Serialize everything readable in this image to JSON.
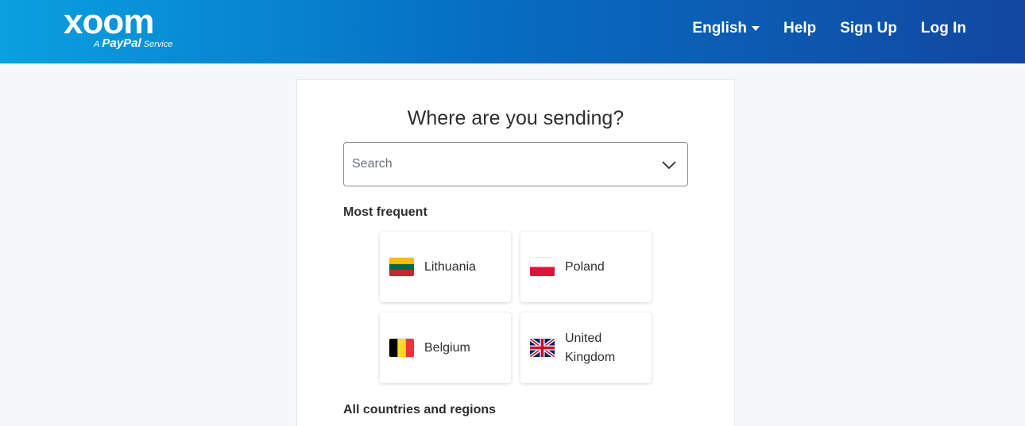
{
  "header": {
    "logo": {
      "wordmark": "xoom",
      "tagline_prefix": "A",
      "tagline_brand": "PayPal",
      "tagline_suffix": "Service"
    },
    "nav": {
      "language": "English",
      "help": "Help",
      "sign_up": "Sign Up",
      "log_in": "Log In"
    }
  },
  "main": {
    "title": "Where are you sending?",
    "search": {
      "placeholder": "Search",
      "value": ""
    },
    "most_frequent_label": "Most frequent",
    "all_label": "All countries and regions",
    "countries": [
      {
        "name": "Lithuania",
        "flag": "lithuania-flag"
      },
      {
        "name": "Poland",
        "flag": "poland-flag"
      },
      {
        "name": "Belgium",
        "flag": "belgium-flag"
      },
      {
        "name": "United Kingdom",
        "flag": "uk-flag"
      }
    ]
  },
  "colors": {
    "header_gradient_start": "#0aa0e0",
    "header_gradient_end": "#1247a0",
    "background": "#f5f7fa"
  }
}
